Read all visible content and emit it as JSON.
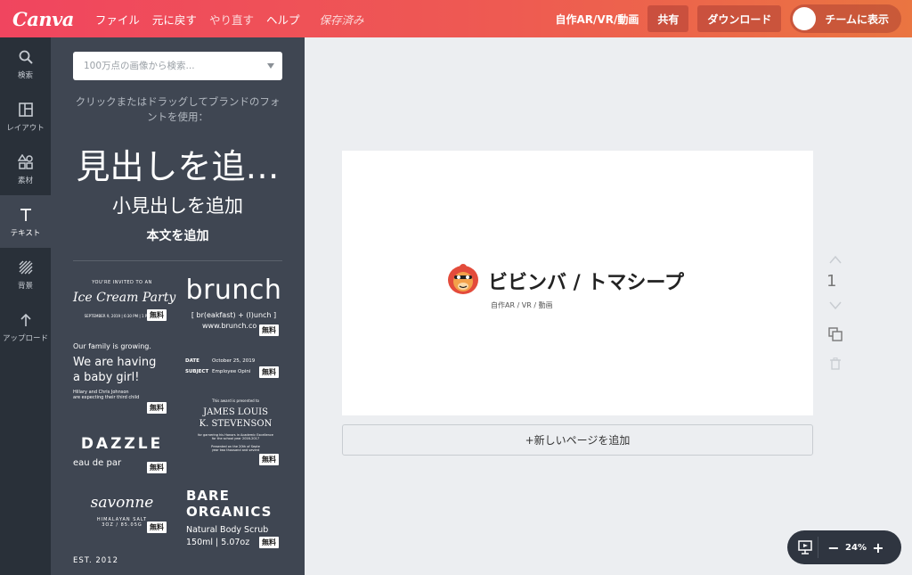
{
  "topbar": {
    "logo": "Canva",
    "menu": [
      "ファイル",
      "元に戻す",
      "やり直す",
      "ヘルプ"
    ],
    "saved": "保存済み",
    "project_title": "自作AR/VR/動画",
    "share": "共有",
    "download": "ダウンロード",
    "team": "チームに表示"
  },
  "rail": [
    {
      "label": "検索",
      "icon": "search-icon"
    },
    {
      "label": "レイアウト",
      "icon": "layout-icon"
    },
    {
      "label": "素材",
      "icon": "elements-icon"
    },
    {
      "label": "テキスト",
      "icon": "text-icon"
    },
    {
      "label": "背景",
      "icon": "background-icon"
    },
    {
      "label": "アップロード",
      "icon": "upload-icon"
    }
  ],
  "panel": {
    "search_placeholder": "100万点の画像から検索...",
    "hint": "クリックまたはドラッグしてブランドのフォントを使用：",
    "heading": "見出しを追…",
    "subheading": "小見出しを追加",
    "body": "本文を追加",
    "free_badge": "無料",
    "templates": {
      "ice_cream_top": "YOU'RE INVITED TO AN",
      "ice_cream_title": "Ice Cream Party",
      "ice_cream_date": "SEPTEMBER 9, 2019 | 6:30 PM | 1 PARK ST",
      "brunch_title": "brunch",
      "brunch_sub": "[ br(eakfast) + (l)unch ]",
      "brunch_url": "www.brunch.co",
      "family_top": "Our family is growing.",
      "family_title_1": "We are having",
      "family_title_2": "a baby girl!",
      "family_small_1": "Hillary and Chris Johnson",
      "family_small_2": "are expecting their third child",
      "date_label": "DATE",
      "date_value": "October 25, 2019",
      "subject_label": "SUBJECT",
      "subject_value": "Employee Opini",
      "award_top": "This award is presented to",
      "award_name_1": "JAMES LOUIS",
      "award_name_2": "K. STEVENSON",
      "award_small_1": "for garnering his Honors in Academic Excellence",
      "award_small_2": "for the school year 2016-2017",
      "award_small_3": "Presented on the 20th of Septe",
      "award_small_4": "year two thousand and sevent",
      "dazzle_title": "DAZZLE",
      "dazzle_sub": "eau de par",
      "savonne_title": "savonne",
      "savonne_sub_1": "HIMALAYAN SALT",
      "savonne_sub_2": "3OZ / 85.05G",
      "bare_1": "BARE",
      "bare_2": "ORGANICS",
      "bare_3": "Natural Body Scrub",
      "bare_4": "150ml | 5.07oz",
      "est": "EST. 2012"
    }
  },
  "canvas": {
    "brand_name": "ビビンバ / トマシープ",
    "brand_sub": "自作AR / VR / 動画",
    "add_page": "+新しいページを追加",
    "page_number": "1"
  },
  "zoom": {
    "minus": "−",
    "value": "24%",
    "plus": "+"
  },
  "colors": {
    "accent_start": "#f0455f",
    "accent_end": "#ea7541",
    "rail": "#293039",
    "panel": "#3f4652"
  }
}
